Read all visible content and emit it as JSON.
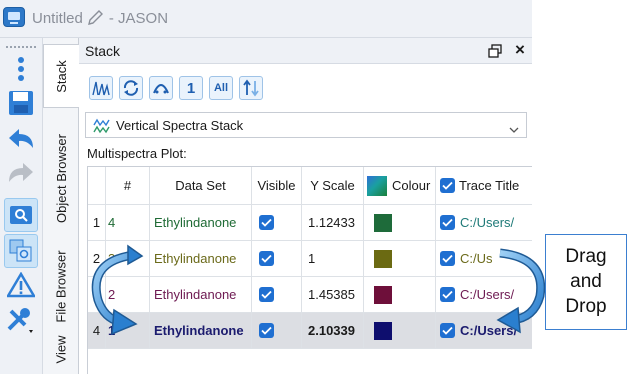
{
  "window": {
    "title_name": "Untitled",
    "title_app": " - JASON"
  },
  "toolbar": {
    "buttons": [
      {
        "name": "more-options-icon"
      },
      {
        "name": "save-icon"
      },
      {
        "name": "undo-icon"
      },
      {
        "name": "redo-icon"
      },
      {
        "name": "zoom-icon",
        "selected": true
      },
      {
        "name": "zoom-region-icon",
        "selected": true
      },
      {
        "name": "warning-icon"
      },
      {
        "name": "tools-icon"
      }
    ]
  },
  "side_tabs": [
    "Stack",
    "Object Browser",
    "File Browser",
    "View"
  ],
  "panel": {
    "title": "Stack",
    "tools": [
      {
        "name": "stack-spectra-icon",
        "text": ""
      },
      {
        "name": "refresh-icon",
        "text": ""
      },
      {
        "name": "arc-icon",
        "text": ""
      },
      {
        "name": "one-button",
        "text": "1"
      },
      {
        "name": "all-button",
        "text": "All"
      },
      {
        "name": "sort-icon",
        "text": ""
      }
    ],
    "stack_mode": "Vertical Spectra Stack",
    "multispectra_label": "Multispectra Plot:",
    "columns": [
      "#",
      "Data Set",
      "Visible",
      "Y Scale",
      "Colour",
      "Trace Title"
    ],
    "rows": [
      {
        "row": "1",
        "num": "4",
        "dataset": "Ethylindanone",
        "visible": true,
        "yscale": "1.12433",
        "color": "#1e6b3a",
        "trace": "C:/Users/",
        "color_class": "green"
      },
      {
        "row": "2",
        "num": "3",
        "dataset": "Ethylindanone",
        "visible": true,
        "yscale": "1",
        "color": "#6b6a12",
        "trace": "C:/Us",
        "color_class": "olive"
      },
      {
        "row": "3",
        "num": "2",
        "dataset": "Ethylindanone",
        "visible": true,
        "yscale": "1.45385",
        "color": "#6e0f3a",
        "trace": "C:/Users/",
        "color_class": "purple"
      },
      {
        "row": "4",
        "num": "1",
        "dataset": "Ethylindanone",
        "visible": true,
        "yscale": "2.10339",
        "color": "#0e0e6e",
        "trace": "C:/Users/",
        "color_class": "navy",
        "selected": true
      }
    ]
  },
  "annotation": {
    "line1": "Drag",
    "line2": "and",
    "line3": "Drop"
  },
  "colors": {
    "accent": "#1f6fd1",
    "arrow": "#2f8fd8"
  }
}
